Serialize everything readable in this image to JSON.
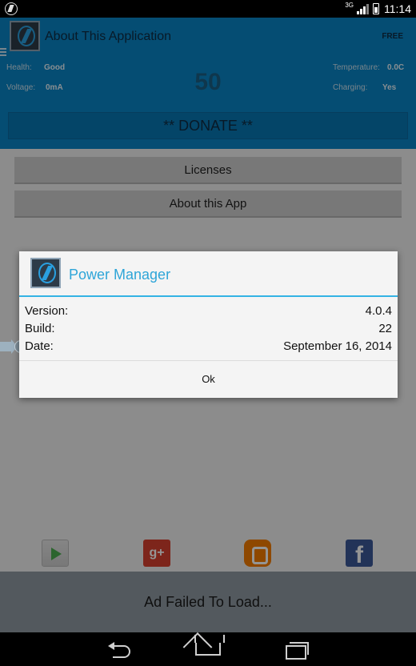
{
  "status_bar": {
    "network_type": "3G",
    "time": "11:14"
  },
  "header": {
    "title": "About This Application",
    "badge": "FREE",
    "health_label": "Health:",
    "health_value": "Good",
    "voltage_label": "Voltage:",
    "voltage_value": "0mA",
    "temperature_label": "Temperature:",
    "temperature_value": "0.0C",
    "charging_label": "Charging:",
    "charging_value": "Yes",
    "battery_level": "50",
    "accent_color": "#0a86c6"
  },
  "donate_button": "** DONATE **",
  "menu": {
    "licenses": "Licenses",
    "about": "About this App"
  },
  "dialog": {
    "title": "Power Manager",
    "rows": [
      {
        "label": "Version:",
        "value": "4.0.4"
      },
      {
        "label": "Build:",
        "value": "22"
      },
      {
        "label": "Date:",
        "value": "September 16, 2014"
      }
    ],
    "ok_label": "Ok",
    "title_color": "#2ea5d8"
  },
  "social_icons": {
    "play": "google-play-icon",
    "gplus": "google-plus-icon",
    "gplus_glyph": "g+",
    "blogger": "blogger-icon",
    "facebook": "facebook-icon",
    "facebook_glyph": "f"
  },
  "ad": {
    "text": "Ad Failed To Load..."
  },
  "nav": {
    "back": "back-icon",
    "home": "home-icon",
    "recents": "recents-icon"
  }
}
